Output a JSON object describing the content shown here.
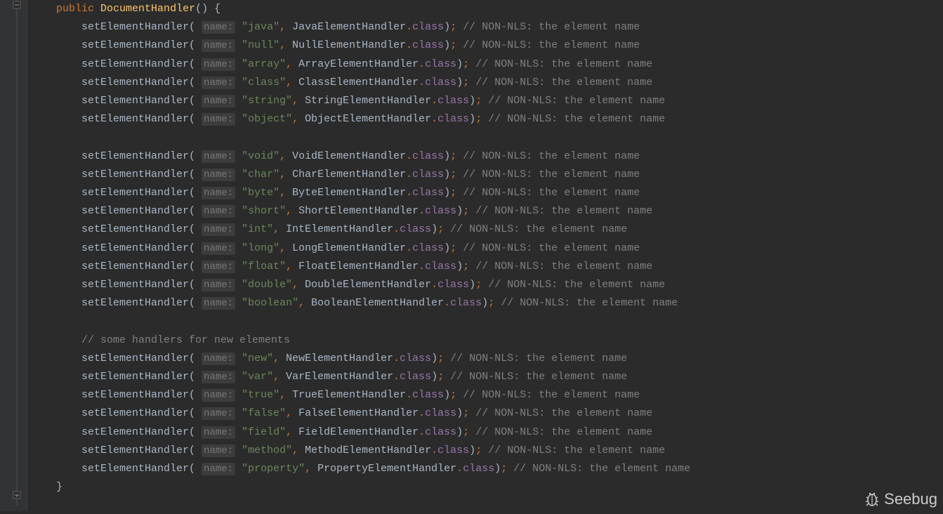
{
  "signature": {
    "public_kw": "public",
    "ctor_name": "DocumentHandler",
    "open": "() {"
  },
  "method": "setElementHandler",
  "hint_label": "name:",
  "class_field": "class",
  "comment_common": "// NON-NLS: the element name",
  "groups": [
    {
      "blank_before": false,
      "comment": null,
      "lines": [
        {
          "str": "\"java\"",
          "handler": "JavaElementHandler"
        },
        {
          "str": "\"null\"",
          "handler": "NullElementHandler"
        },
        {
          "str": "\"array\"",
          "handler": "ArrayElementHandler"
        },
        {
          "str": "\"class\"",
          "handler": "ClassElementHandler"
        },
        {
          "str": "\"string\"",
          "handler": "StringElementHandler"
        },
        {
          "str": "\"object\"",
          "handler": "ObjectElementHandler"
        }
      ]
    },
    {
      "blank_before": true,
      "comment": null,
      "lines": [
        {
          "str": "\"void\"",
          "handler": "VoidElementHandler"
        },
        {
          "str": "\"char\"",
          "handler": "CharElementHandler"
        },
        {
          "str": "\"byte\"",
          "handler": "ByteElementHandler"
        },
        {
          "str": "\"short\"",
          "handler": "ShortElementHandler"
        },
        {
          "str": "\"int\"",
          "handler": "IntElementHandler"
        },
        {
          "str": "\"long\"",
          "handler": "LongElementHandler"
        },
        {
          "str": "\"float\"",
          "handler": "FloatElementHandler"
        },
        {
          "str": "\"double\"",
          "handler": "DoubleElementHandler"
        },
        {
          "str": "\"boolean\"",
          "handler": "BooleanElementHandler"
        }
      ]
    },
    {
      "blank_before": true,
      "comment": "// some handlers for new elements",
      "lines": [
        {
          "str": "\"new\"",
          "handler": "NewElementHandler"
        },
        {
          "str": "\"var\"",
          "handler": "VarElementHandler"
        },
        {
          "str": "\"true\"",
          "handler": "TrueElementHandler"
        },
        {
          "str": "\"false\"",
          "handler": "FalseElementHandler"
        },
        {
          "str": "\"field\"",
          "handler": "FieldElementHandler"
        },
        {
          "str": "\"method\"",
          "handler": "MethodElementHandler"
        },
        {
          "str": "\"property\"",
          "handler": "PropertyElementHandler"
        }
      ]
    }
  ],
  "closing_brace": "}",
  "watermark": "Seebug"
}
